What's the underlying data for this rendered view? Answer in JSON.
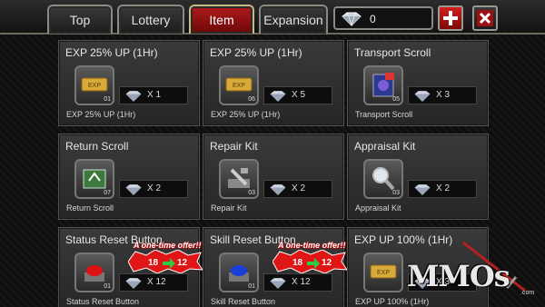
{
  "tabs": [
    {
      "label": "Top",
      "active": false
    },
    {
      "label": "Lottery",
      "active": false
    },
    {
      "label": "Item",
      "active": true
    },
    {
      "label": "Expansion",
      "active": false
    }
  ],
  "currency": {
    "value": "0"
  },
  "items": [
    {
      "title": "EXP 25% UP (1Hr)",
      "badge": "01",
      "qty": "X 1",
      "desc": "EXP 25% UP (1Hr)",
      "icon": "exp-ticket-icon"
    },
    {
      "title": "EXP 25% UP (1Hr)",
      "badge": "06",
      "qty": "X 5",
      "desc": "EXP 25% UP (1Hr)",
      "icon": "exp-ticket-icon"
    },
    {
      "title": "Transport Scroll",
      "badge": "05",
      "qty": "X 3",
      "desc": "Transport Scroll",
      "icon": "transport-scroll-icon"
    },
    {
      "title": "Return Scroll",
      "badge": "07",
      "qty": "X 2",
      "desc": "Return Scroll",
      "icon": "return-scroll-icon"
    },
    {
      "title": "Repair Kit",
      "badge": "03",
      "qty": "X 2",
      "desc": "Repair Kit",
      "icon": "repair-kit-icon"
    },
    {
      "title": "Appraisal Kit",
      "badge": "03",
      "qty": "X 2",
      "desc": "Appraisal Kit",
      "icon": "magnifier-icon"
    },
    {
      "title": "Status Reset Button",
      "badge": "01",
      "qty": "X 12",
      "desc": "Status Reset Button",
      "icon": "red-button-icon"
    },
    {
      "title": "Skill Reset Button",
      "badge": "01",
      "qty": "X 12",
      "desc": "Skill Reset Button",
      "icon": "blue-button-icon"
    },
    {
      "title": "EXP UP 100% (1Hr)",
      "badge": "",
      "qty": "X 3",
      "desc": "EXP UP 100% (1Hr)",
      "icon": "exp-ticket-icon"
    }
  ],
  "promos": [
    {
      "text": "A one-time offer!!",
      "old": "18",
      "new": "12"
    },
    {
      "text": "A one-time offer!!",
      "old": "18",
      "new": "12"
    }
  ],
  "watermark": {
    "text": "MMOs",
    "sub": ".com"
  },
  "colors": {
    "active_tab": "#b01b1b",
    "add_button": "#d01e1e",
    "arrow": "#2ecc40"
  }
}
